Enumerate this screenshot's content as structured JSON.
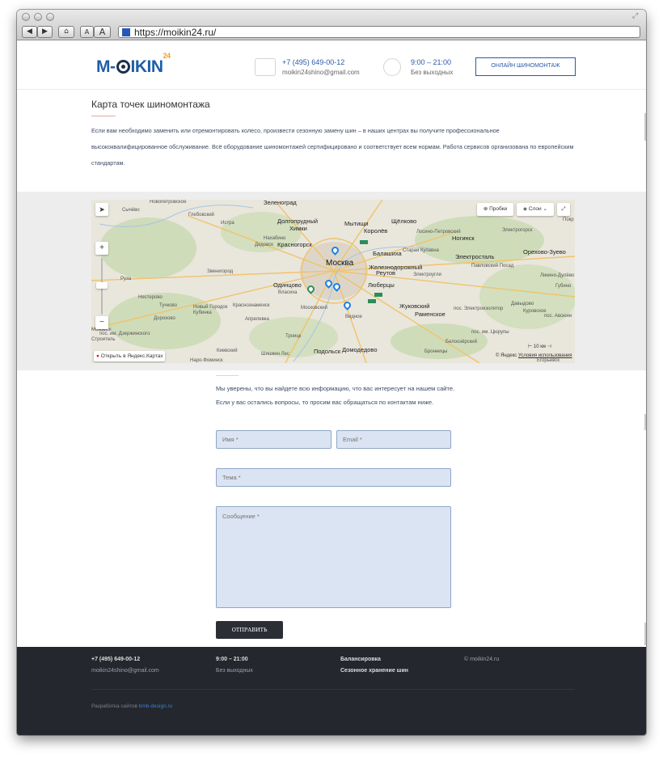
{
  "browser": {
    "url": "https://moikin24.ru/",
    "text_size_small": "A",
    "text_size_large": "A"
  },
  "header": {
    "logo_text_left": "M-",
    "logo_text_right": "IKIN",
    "logo_sup": "24",
    "phone": "+7 (495) 649-00-12",
    "email": "moikin24shino@gmail.com",
    "hours": "9:00 – 21:00",
    "days": "Без выходных",
    "cta_label": "ОНЛАЙН ШИНОМОНТАЖ"
  },
  "content": {
    "title": "Карта точек шиномонтажа",
    "intro": "Если вам необходимо заменить или отремонтировать колесо, произвести сезонную замену шин – в наших центрах вы получите профессиональное высококвалифицированное обслуживание. Всё оборудование шиномонтажей сертифицировано и соответствует всем нормам. Работа сервисов организована по европейским стандартам."
  },
  "map": {
    "traffic_btn": "Пробки",
    "layers_btn": "Слои",
    "open_link": "Открыть в Яндекс.Картах",
    "scale": "10 км",
    "copyright": "© Яндекс",
    "terms": "Условия использования",
    "labels": {
      "zelenograd": "Зеленоград",
      "novopetrovskoe": "Новопетровское",
      "sychevo": "Сычёво",
      "glebovskiy": "Глебовский",
      "istra": "Истра",
      "dolgoprudny": "Долгопрудный",
      "khimki": "Химки",
      "mytishchi": "Мытищи",
      "korolev": "Королёв",
      "shchelkovo": "Щёлково",
      "nakhabino": "Нахабино",
      "dedovsk": "Дедовск",
      "krasnogorsk": "Красногорск",
      "losino": "Лосино-Петровский",
      "noginsk": "Ногинск",
      "elektrogorsk": "Электрогорск",
      "pokrov": "Покр",
      "moskva": "Москва",
      "balashikha": "Балашиха",
      "staraya_kupavna": "Старая Купавна",
      "elektrostal": "Электросталь",
      "orekhovo": "Орехово-Зуево",
      "zheleznodorozhny": "Железнодорожный",
      "reutov": "Реутов",
      "pavlovsky_posad": "Павловский Посад",
      "zvenigorod": "Звенигород",
      "ruza": "Руза",
      "odintsovo": "Одинцово",
      "vlasikha": "Власиха",
      "lyubertsy": "Люберцы",
      "elektrougli": "Электроугли",
      "likino": "Ликино-Дулёво",
      "gubino": "Губино",
      "nesterovo": "Нестерово",
      "tuchkovo": "Тучково",
      "novy_gorodok": "Новый Городок",
      "krasnoznamensk": "Краснознаменск",
      "kubinka": "Кубинка",
      "moskovsky": "Московский",
      "zhukovsky": "Жуковский",
      "ramenskoe": "Раменское",
      "elektrozavodsk": "пос. Электроизолятор",
      "davydovo": "Давыдово",
      "kurovskoe": "Куровское",
      "avsyunino": "пос. Авсюни",
      "dorokhovo": "Дорохово",
      "aprelevka": "Апрелевка",
      "vidnoe": "Видное",
      "mozhaysk": "Можайск",
      "dzerzhinskogo": "пос. им. Дзержинского",
      "stroitel": "Строитель",
      "troitsk": "Троицк",
      "tsyurupy": "пос. им. Цюрупы",
      "beloozersky": "Белоозёрский",
      "kievsky": "Киевский",
      "shishkin_les": "Шишкин Лес",
      "podolsk": "Подольск",
      "domodedovo": "Домодедово",
      "bronnitsy": "Бронницы",
      "naro_fominsk": "Наро-Фоминск",
      "egoryevsk": "Егорьевск"
    }
  },
  "form": {
    "intro": "Мы уверены, что вы найдете всю информацию, что вас интересует на нашем сайте. Если у вас остались вопросы, то просим вас обращаться по контактам ниже.",
    "name_placeholder": "Имя *",
    "email_placeholder": "Email *",
    "subject_placeholder": "Тема *",
    "message_placeholder": "Сообщение *",
    "submit_label": "ОТПРАВИТЬ"
  },
  "footer": {
    "phone": "+7 (495) 649-00-12",
    "email": "moikin24shino@gmail.com",
    "hours": "9:00 – 21:00",
    "days": "Без выходных",
    "link1": "Балансировка",
    "link2": "Сезонное хранение шин",
    "copyright": "© moikin24.ru",
    "credit_prefix": "Разработка сайтов",
    "credit_link": "bmb-design.ru"
  },
  "colors": {
    "brand_blue": "#2a5aa8",
    "footer_bg": "#24272d",
    "field_bg": "#dbe4f2",
    "pin_blue": "#1d7fe0"
  },
  "icons": [
    "back-arrow-icon",
    "forward-arrow-icon",
    "home-icon",
    "resize-icon",
    "chat-icon",
    "alarm-clock-icon",
    "locate-icon",
    "zoom-in-icon",
    "zoom-out-icon",
    "traffic-icon",
    "layers-icon",
    "fullscreen-icon",
    "yandex-pin-icon",
    "map-pin-icon"
  ]
}
